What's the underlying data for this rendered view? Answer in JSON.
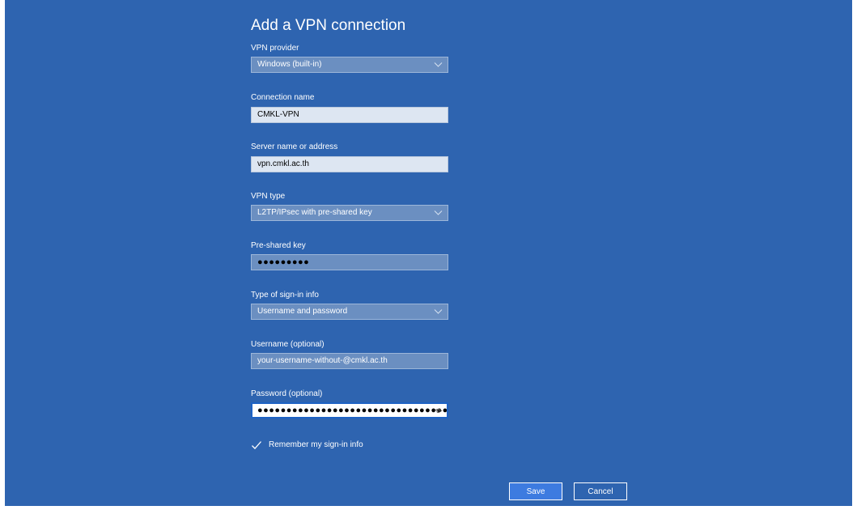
{
  "dialog": {
    "title": "Add a VPN connection"
  },
  "vpn_provider": {
    "label": "VPN provider",
    "value": "Windows (built-in)"
  },
  "connection_name": {
    "label": "Connection name",
    "value": "CMKL-VPN"
  },
  "server": {
    "label": "Server name or address",
    "value": "vpn.cmkl.ac.th"
  },
  "vpn_type": {
    "label": "VPN type",
    "value": "L2TP/IPsec with pre-shared key"
  },
  "preshared_key": {
    "label": "Pre-shared key",
    "value": "●●●●●●●●●"
  },
  "signin_type": {
    "label": "Type of sign-in info",
    "value": "Username and password"
  },
  "username": {
    "label": "Username (optional)",
    "value": "your-username-without-@cmkl.ac.th"
  },
  "password": {
    "label": "Password (optional)",
    "value": "●●●●●●●●●●●●●●●●●●●●●●●●●●●●●●●●●"
  },
  "remember": {
    "label": "Remember my sign-in info",
    "checked": true
  },
  "actions": {
    "save_label": "Save",
    "cancel_label": "Cancel"
  },
  "colors": {
    "background": "#2e64b0",
    "accent": "#3d7be0"
  }
}
